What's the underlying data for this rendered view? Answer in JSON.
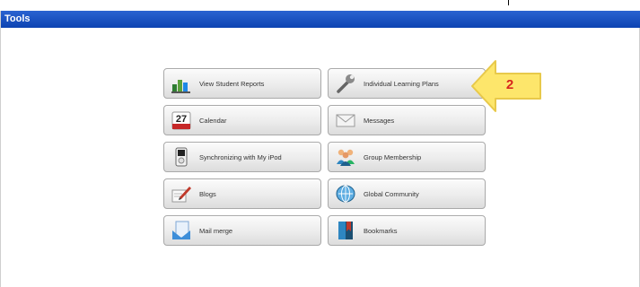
{
  "window": {
    "title": "Tools"
  },
  "tools": [
    {
      "label": "View Student Reports",
      "icon": "reports-icon"
    },
    {
      "label": "Individual Learning Plans",
      "icon": "wrench-icon"
    },
    {
      "label": "Calendar",
      "icon": "calendar-icon",
      "icon_text": "27"
    },
    {
      "label": "Messages",
      "icon": "envelope-icon"
    },
    {
      "label": "Synchronizing with My iPod",
      "icon": "ipod-icon"
    },
    {
      "label": "Group Membership",
      "icon": "group-icon"
    },
    {
      "label": "Blogs",
      "icon": "blog-pen-icon"
    },
    {
      "label": "Global Community",
      "icon": "globe-icon"
    },
    {
      "label": "Mail merge",
      "icon": "mail-merge-icon"
    },
    {
      "label": "Bookmarks",
      "icon": "bookmarks-icon"
    }
  ],
  "callout": {
    "number": "2",
    "color": "#fde66b",
    "number_color": "#d7261e"
  },
  "colors": {
    "titlebar": "#1a4fc0"
  }
}
